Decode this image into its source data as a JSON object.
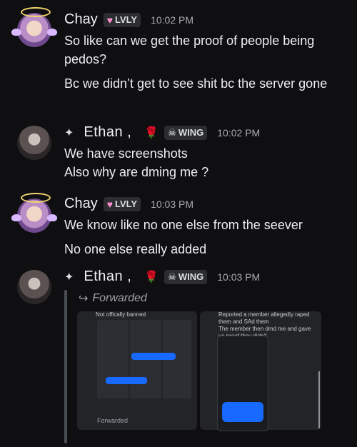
{
  "messages": [
    {
      "author": "Chay",
      "badge": "LVLY",
      "time": "10:02 PM",
      "lines": [
        "So like can we get the proof of people being pedos?",
        "Bc we didn’t get to see shit bc the server gone"
      ]
    },
    {
      "author": "Ethan ,",
      "badge": "WING",
      "time": "10:02 PM",
      "lines": [
        "We have screenshots",
        "Also why are dming me ?"
      ]
    },
    {
      "author": "Chay",
      "badge": "LVLY",
      "time": "10:03 PM",
      "lines": [
        "We know like no one else from the seever",
        "No one else really added"
      ]
    },
    {
      "author": "Ethan ,",
      "badge": "WING",
      "time": "10:03 PM",
      "forwarded_label": "Forwarded",
      "attachments": {
        "left_caption": "Not offically banned",
        "right_caption": "Reported a member allegedly raped them and SAd them\nThe member then dmd me and gave us proof they didn't",
        "left_footer": "Forwarded"
      }
    }
  ],
  "colors": {
    "background": "#0f0f12",
    "badge_bg": "#2b2d31",
    "heart": "#ff8fd1",
    "blue_redaction": "#1769ff"
  }
}
